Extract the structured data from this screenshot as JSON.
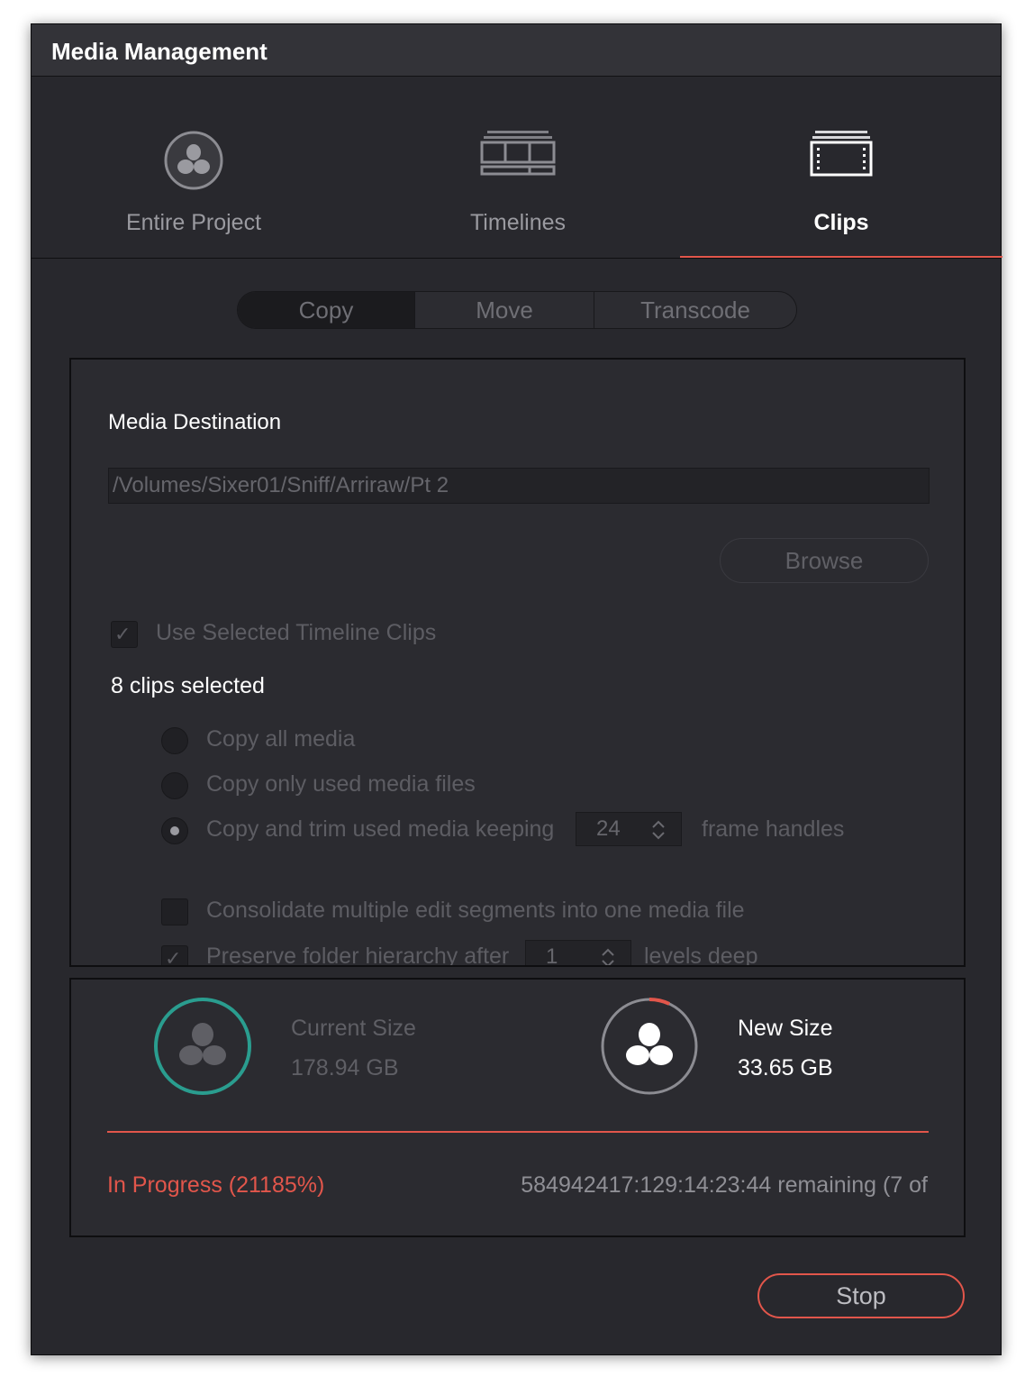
{
  "window": {
    "title": "Media Management"
  },
  "modes": [
    {
      "label": "Entire Project",
      "icon": "resolve-logo-icon",
      "active": false
    },
    {
      "label": "Timelines",
      "icon": "timeline-icon",
      "active": false
    },
    {
      "label": "Clips",
      "icon": "film-clip-icon",
      "active": true
    }
  ],
  "operations": [
    {
      "label": "Copy",
      "active": true
    },
    {
      "label": "Move",
      "active": false
    },
    {
      "label": "Transcode",
      "active": false
    }
  ],
  "destination": {
    "label": "Media Destination",
    "path": "/Volumes/Sixer01/Sniff/Arriraw/Pt 2",
    "browse_label": "Browse"
  },
  "options": {
    "use_selected_label": "Use Selected Timeline Clips",
    "use_selected_checked": true,
    "clips_selected": "8 clips selected",
    "radio_copy_all": "Copy all media",
    "radio_copy_used": "Copy only used media files",
    "radio_copy_trim": "Copy and trim used media keeping",
    "radio_selected": "copy_trim",
    "handles_value": "24",
    "handles_suffix": "frame handles",
    "consolidate_label": "Consolidate multiple edit segments into one media file",
    "consolidate_checked": false,
    "preserve_label": "Preserve folder hierarchy after",
    "preserve_value": "1",
    "preserve_suffix": "levels deep",
    "preserve_checked": true
  },
  "sizes": {
    "current_label": "Current Size",
    "current_value": "178.94 GB",
    "new_label": "New Size",
    "new_value": "33.65 GB",
    "new_ring_fraction": 0.07
  },
  "progress": {
    "status": "In Progress (21185%)",
    "remaining": "584942417:129:14:23:44 remaining (7 of"
  },
  "actions": {
    "stop_label": "Stop"
  },
  "colors": {
    "accent": "#e2564b",
    "teal": "#2a9d8f",
    "window_bg": "#28282d"
  }
}
